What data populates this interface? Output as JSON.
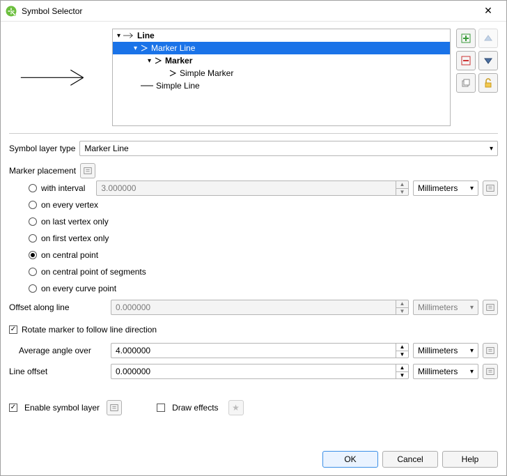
{
  "window": {
    "title": "Symbol Selector"
  },
  "tree": {
    "root": "Line",
    "marker_line": "Marker Line",
    "marker": "Marker",
    "simple_marker": "Simple Marker",
    "simple_line": "Simple Line"
  },
  "symbol_layer_type": {
    "label": "Symbol layer type",
    "value": "Marker Line"
  },
  "marker_placement": {
    "label": "Marker placement",
    "options": {
      "with_interval": "with interval",
      "every_vertex": "on every vertex",
      "last_vertex": "on last vertex only",
      "first_vertex": "on first vertex only",
      "central_point": "on central point",
      "central_segments": "on central point of segments",
      "every_curve": "on every curve point"
    },
    "interval_value": "3.000000",
    "interval_unit": "Millimeters"
  },
  "offset_along": {
    "label": "Offset along line",
    "value": "0.000000",
    "unit": "Millimeters"
  },
  "rotate_marker": {
    "label": "Rotate marker to follow line direction",
    "checked": true
  },
  "avg_angle": {
    "label": "Average angle over",
    "value": "4.000000",
    "unit": "Millimeters"
  },
  "line_offset": {
    "label": "Line offset",
    "value": "0.000000",
    "unit": "Millimeters"
  },
  "enable_layer": {
    "label": "Enable symbol layer",
    "checked": true
  },
  "draw_effects": {
    "label": "Draw effects",
    "checked": false
  },
  "buttons": {
    "ok": "OK",
    "cancel": "Cancel",
    "help": "Help"
  },
  "icons": {
    "add": "add",
    "remove": "remove",
    "up": "up",
    "down": "down",
    "copy": "copy",
    "lock": "lock"
  }
}
